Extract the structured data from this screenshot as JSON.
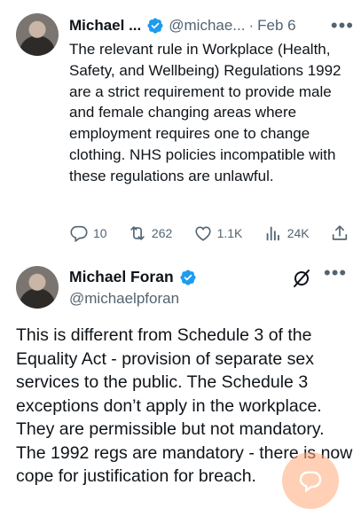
{
  "tweet1": {
    "name": "Michael ...",
    "handle": "@michae...",
    "separator": "·",
    "date": "Feb 6",
    "more_icon": "more-icon",
    "text": "The relevant rule in Workplace (Health, Safety, and Wellbeing) Regulations 1992 are a strict requirement to provide male and female changing areas where employment requires one to change clothing. NHS policies incompatible with these regulations are unlawful.",
    "actions": {
      "replies": "10",
      "reposts": "262",
      "likes": "1.1K",
      "views": "24K"
    }
  },
  "tweet2": {
    "name": "Michael Foran",
    "handle": "@michaelpforan",
    "text": "This is different from Schedule 3 of the Equality Act - provision of separate sex services to the public. The Schedule 3 exceptions don’t apply in the workplace. They are permissible but not mandatory. The 1992 regs are mandatory - there is now cope for justification for breach."
  },
  "colors": {
    "verified": "#1d9bf0",
    "secondary_text": "#536471",
    "fab": "#ffaa78"
  }
}
